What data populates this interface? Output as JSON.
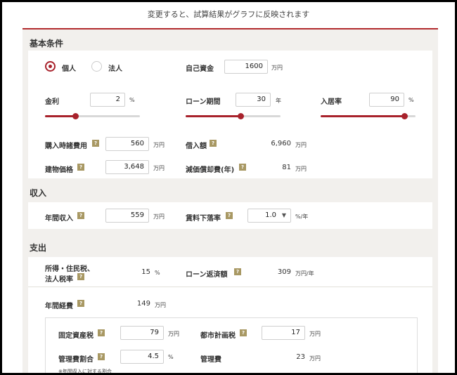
{
  "header": {
    "text": "変更すると、試算結果がグラフに反映されます"
  },
  "sections": {
    "basic": "基本条件",
    "income": "収入",
    "expense": "支出"
  },
  "basic": {
    "radio_individual": "個人",
    "radio_corporate": "法人",
    "own_funds_label": "自己資金",
    "own_funds_value": "1600",
    "own_funds_unit": "万円",
    "interest_label": "金利",
    "interest_value": "2",
    "interest_unit": "%",
    "interest_slider": 0.32,
    "loan_term_label": "ローン期間",
    "loan_term_value": "30",
    "loan_term_unit": "年",
    "loan_term_slider": 0.58,
    "occupancy_label": "入居率",
    "occupancy_value": "90",
    "occupancy_unit": "%",
    "occupancy_slider": 0.88,
    "purchase_cost_label": "購入時諸費用",
    "purchase_cost_value": "560",
    "purchase_cost_unit": "万円",
    "borrow_label": "借入額",
    "borrow_value": "6,960",
    "borrow_unit": "万円",
    "building_price_label": "建物価格",
    "building_price_value": "3,648",
    "building_price_unit": "万円",
    "depreciation_label": "減価償却費(年)",
    "depreciation_value": "81",
    "depreciation_unit": "万円"
  },
  "income": {
    "annual_income_label": "年間収入",
    "annual_income_value": "559",
    "annual_income_unit": "万円",
    "rent_decline_label": "賃料下落率",
    "rent_decline_value": "1.0",
    "rent_decline_unit": "%/年"
  },
  "expense": {
    "tax_rate_label_1": "所得・住民税、",
    "tax_rate_label_2": "法人税率",
    "tax_rate_value": "15",
    "tax_rate_unit": "%",
    "loan_repay_label": "ローン返済額",
    "loan_repay_value": "309",
    "loan_repay_unit": "万円/年",
    "annual_cost_label": "年間経費",
    "annual_cost_value": "149",
    "annual_cost_unit": "万円",
    "fixed_asset_label": "固定資産税",
    "fixed_asset_value": "79",
    "fixed_asset_unit": "万円",
    "city_plan_label": "都市計画税",
    "city_plan_value": "17",
    "city_plan_unit": "万円",
    "mgmt_ratio_label": "管理費割合",
    "mgmt_ratio_value": "4.5",
    "mgmt_ratio_unit": "%",
    "mgmt_fee_label": "管理費",
    "mgmt_fee_value": "23",
    "mgmt_fee_unit": "万円",
    "note": "※年間収入に対する割合"
  },
  "help_glyph": "?",
  "colors": {
    "accent": "#a8222c",
    "help": "#a89863",
    "panel": "#f2f0ed"
  }
}
